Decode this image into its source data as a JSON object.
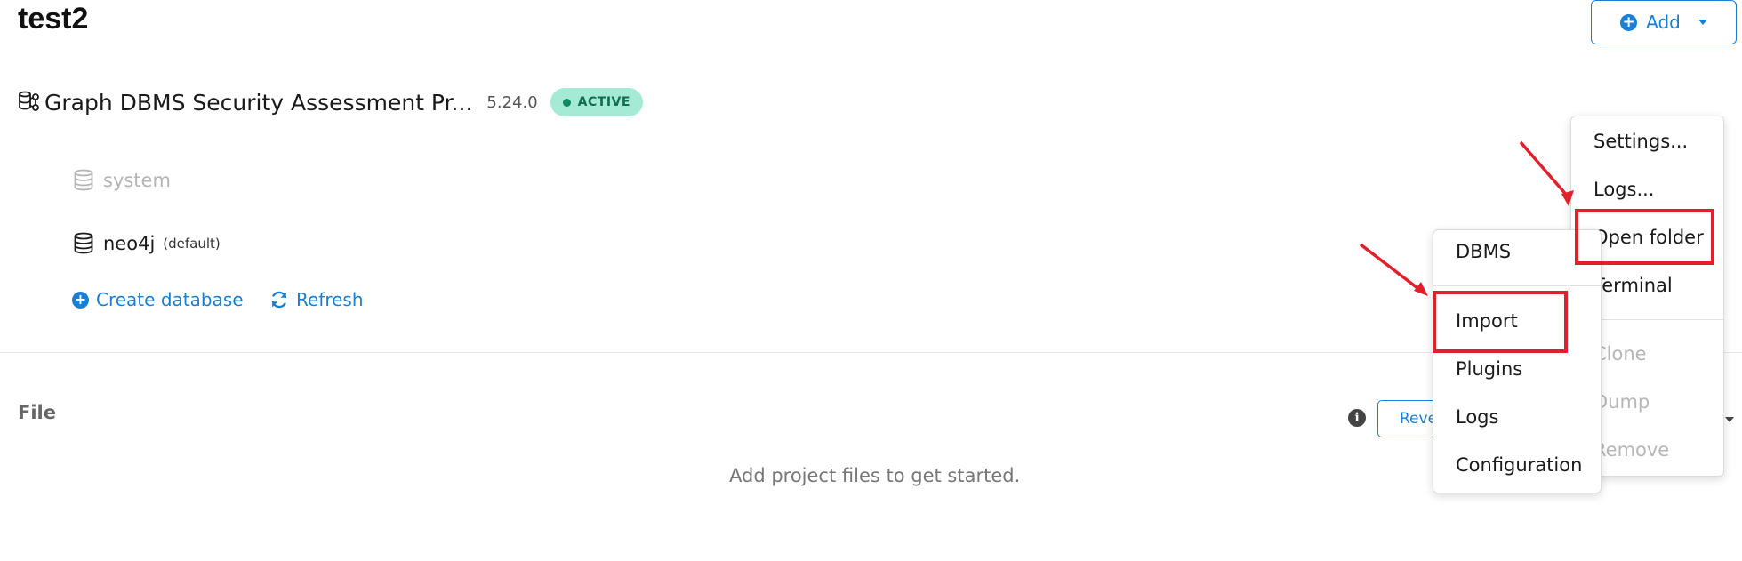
{
  "project": {
    "title": "test2"
  },
  "header": {
    "add_label": "Add"
  },
  "dbms": {
    "name": "Graph DBMS Security Assessment Pr...",
    "version": "5.24.0",
    "status": "ACTIVE"
  },
  "databases": [
    {
      "name": "system",
      "tag": ""
    },
    {
      "name": "neo4j",
      "tag": "(default)"
    }
  ],
  "actions": {
    "create_label": "Create database",
    "refresh_label": "Refresh"
  },
  "files": {
    "section_label": "File",
    "empty_message": "Add project files to get started.",
    "reveal_label": "Reve"
  },
  "menu_right": {
    "items": [
      "Settings...",
      "Logs...",
      "Open folder",
      "Terminal",
      "Clone",
      "Dump",
      "Remove"
    ]
  },
  "menu_left": {
    "items": [
      "DBMS",
      "Import",
      "Plugins",
      "Logs",
      "Configuration"
    ]
  },
  "colors": {
    "accent": "#1a7fd4",
    "badge_bg": "#a4ead4",
    "badge_text": "#0f6e4c",
    "annotation_red": "#e0202a"
  }
}
